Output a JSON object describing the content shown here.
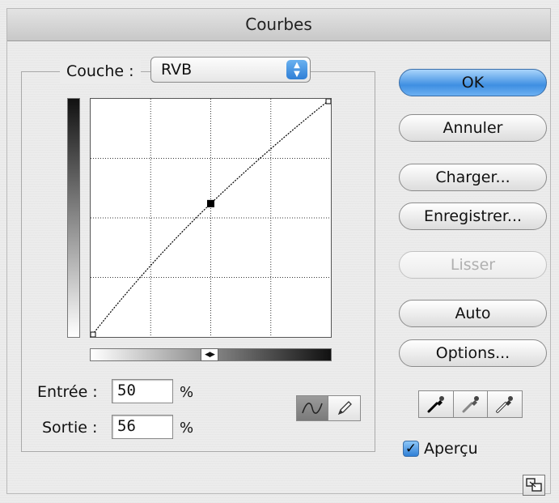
{
  "window": {
    "title": "Courbes"
  },
  "channel": {
    "label": "Couche :",
    "value": "RVB"
  },
  "curve": {
    "points": [
      [
        0,
        0
      ],
      [
        50,
        56
      ],
      [
        100,
        100
      ]
    ],
    "selected_point": [
      50,
      56
    ],
    "grid_divisions": 4
  },
  "fields": {
    "input_label": "Entrée :",
    "input_value": "50",
    "input_unit": "%",
    "output_label": "Sortie :",
    "output_value": "56",
    "output_unit": "%"
  },
  "buttons": {
    "ok": "OK",
    "cancel": "Annuler",
    "load": "Charger...",
    "save": "Enregistrer...",
    "smooth": "Lisser",
    "auto": "Auto",
    "options": "Options..."
  },
  "preview": {
    "label": "Aperçu",
    "checked": true,
    "check_glyph": "✓"
  },
  "icons": {
    "channel_arrows": [
      "▲",
      "▼"
    ],
    "gradient_toggle": "◀▶",
    "tools": [
      "curve-tool-icon",
      "pencil-tool-icon"
    ],
    "droppers": [
      "black-eyedropper-icon",
      "gray-eyedropper-icon",
      "white-eyedropper-icon"
    ]
  },
  "colors": {
    "accent": "#3f8fe2",
    "disabled_text": "#b0b0b0"
  }
}
